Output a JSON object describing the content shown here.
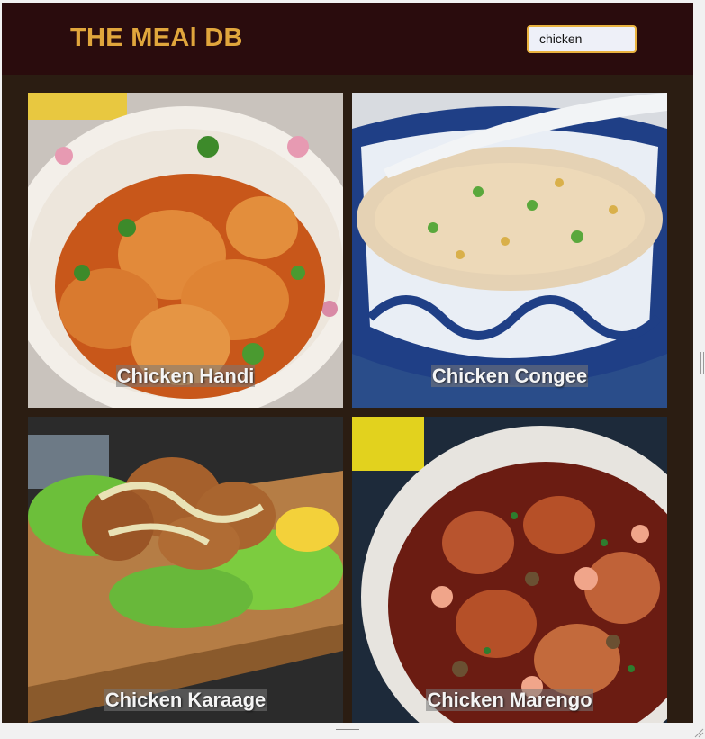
{
  "header": {
    "brand": "THE MEAl DB",
    "search": {
      "value": "chicken",
      "placeholder": ""
    }
  },
  "colors": {
    "page_bg": "#2b1d12",
    "header_bg": "#2a0c0d",
    "brand": "#e0a63c",
    "search_border": "#e9b340"
  },
  "meals": [
    {
      "name": "Chicken Handi",
      "photo": "chicken-handi-photo"
    },
    {
      "name": "Chicken Congee",
      "photo": "chicken-congee-photo"
    },
    {
      "name": "Chicken Karaage",
      "photo": "chicken-karaage-photo"
    },
    {
      "name": "Chicken Marengo",
      "photo": "chicken-marengo-photo"
    }
  ]
}
